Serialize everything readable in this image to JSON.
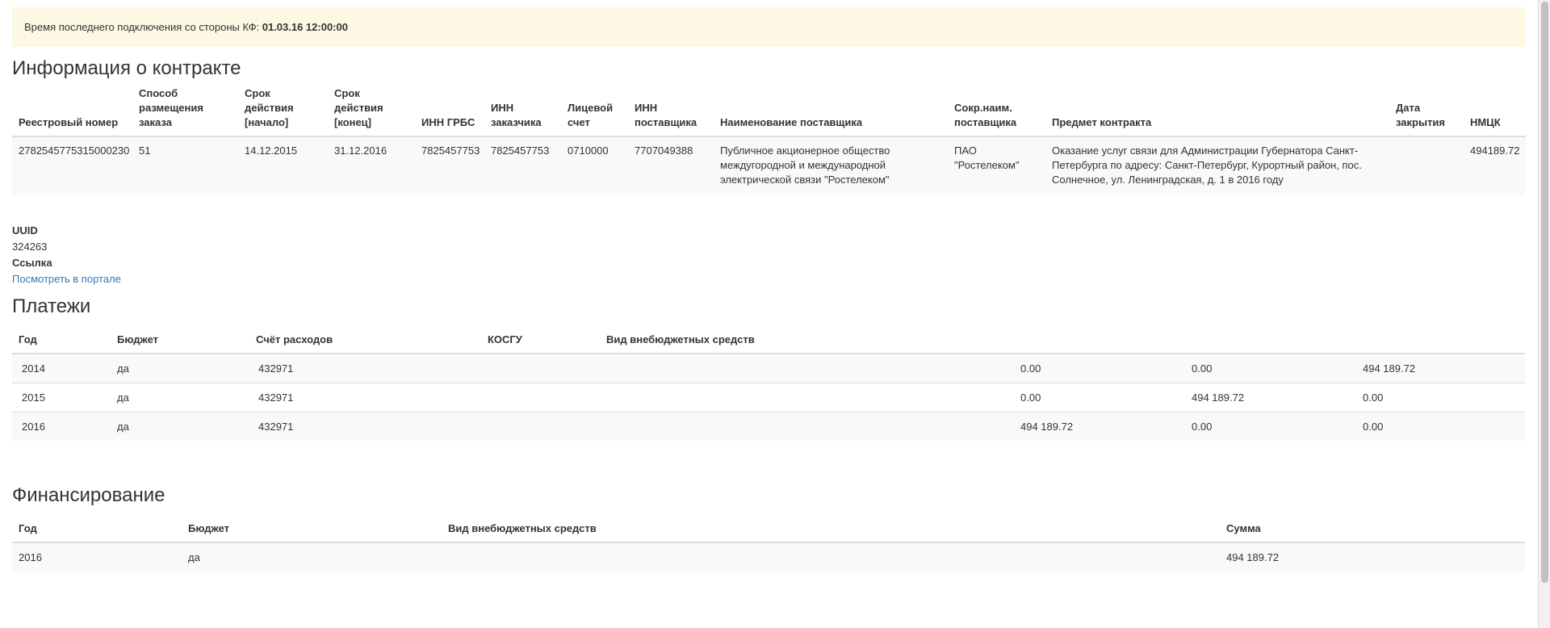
{
  "alert": {
    "prefix": "Время последнего подключения со стороны КФ: ",
    "time": "01.03.16 12:00:00"
  },
  "contract": {
    "heading": "Информация о контракте",
    "columns": [
      "Реестровый номер",
      "Способ размещения заказа",
      "Срок действия [начало]",
      "Срок действия [конец]",
      "ИНН ГРБС",
      "ИНН заказчика",
      "Лицевой счет",
      "ИНН поставщика",
      "Наименование поставщика",
      "Сокр.наим. поставщика",
      "Предмет контракта",
      "Дата закрытия",
      "НМЦК"
    ],
    "row": {
      "reg_number": "2782545775315000230",
      "method": "51",
      "start": "14.12.2015",
      "end": "31.12.2016",
      "inn_grbs": "7825457753",
      "inn_customer": "7825457753",
      "account": "0710000",
      "inn_supplier": "7707049388",
      "supplier_name": "Публичное акционерное общество междугородной и международной электрической связи \"Ростелеком\"",
      "supplier_short": "ПАО \"Ростелеком\"",
      "subject": "Оказание услуг связи для Администрации Губернатора Санкт-Петербурга по адресу: Санкт-Петербург, Курортный район, пос. Солнечное, ул. Ленинградская, д. 1 в 2016 году",
      "close_date": "",
      "nmck": "494189.72"
    }
  },
  "meta": {
    "uuid_label": "UUID",
    "uuid_value": "324263",
    "link_label": "Ссылка",
    "link_text": "Посмотреть в портале"
  },
  "payments": {
    "heading": "Платежи",
    "columns": [
      "Год",
      "Бюджет",
      "Счёт расходов",
      "КОСГУ",
      "Вид внебюджетных средств",
      "",
      "",
      ""
    ],
    "rows": [
      {
        "year": "2014",
        "budget": "да",
        "account": "432971",
        "kosgu": "",
        "kind": "",
        "v1": "0.00",
        "v2": "0.00",
        "v3": "494 189.72"
      },
      {
        "year": "2015",
        "budget": "да",
        "account": "432971",
        "kosgu": "",
        "kind": "",
        "v1": "0.00",
        "v2": "494 189.72",
        "v3": "0.00"
      },
      {
        "year": "2016",
        "budget": "да",
        "account": "432971",
        "kosgu": "",
        "kind": "",
        "v1": "494 189.72",
        "v2": "0.00",
        "v3": "0.00"
      }
    ]
  },
  "financing": {
    "heading": "Финансирование",
    "columns": [
      "Год",
      "Бюджет",
      "Вид внебюджетных средств",
      "Сумма"
    ],
    "rows": [
      {
        "year": "2016",
        "budget": "да",
        "kind": "",
        "sum": "494 189.72"
      }
    ]
  }
}
